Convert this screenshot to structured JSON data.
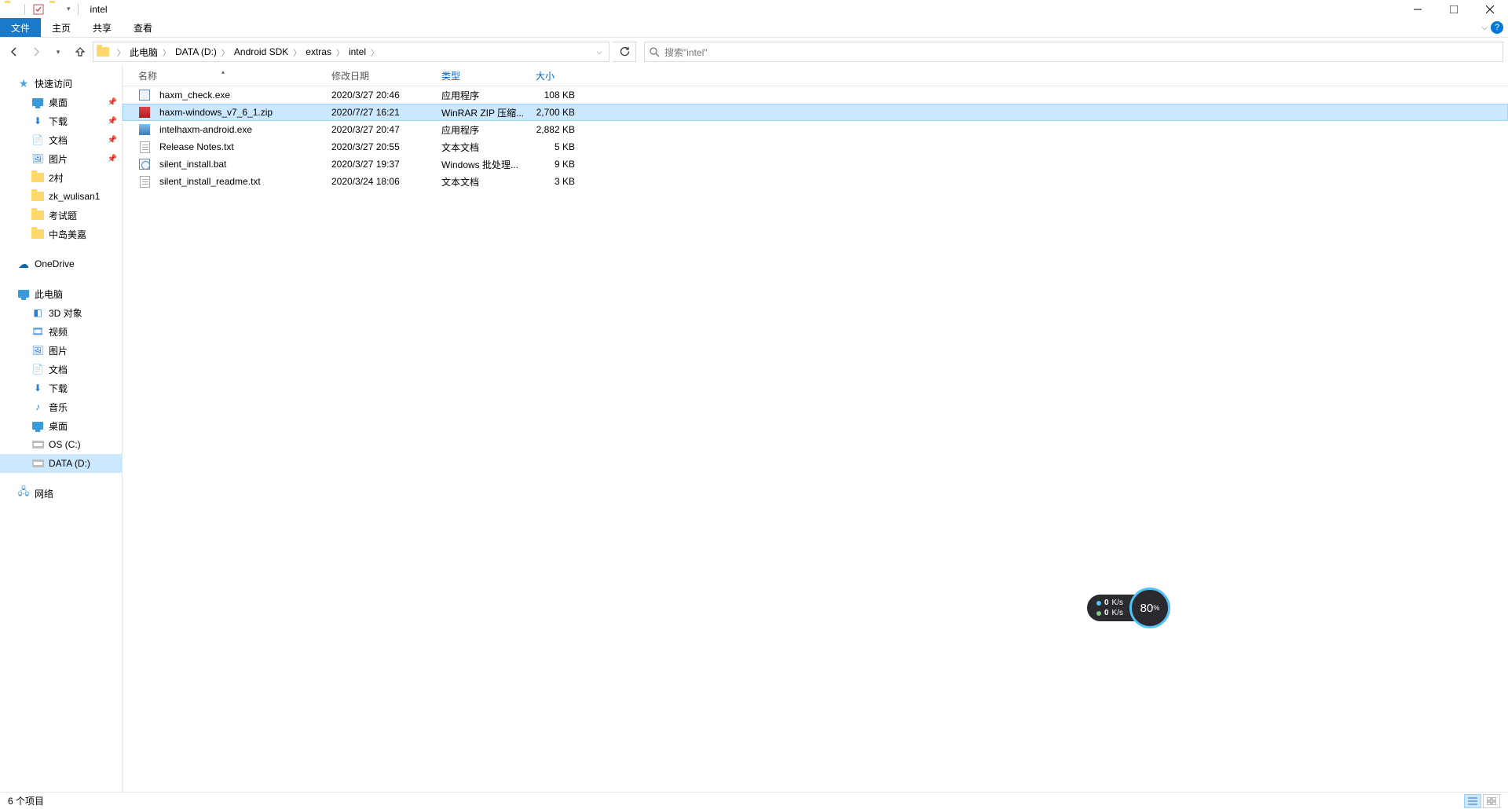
{
  "window": {
    "title": "intel"
  },
  "ribbon": {
    "file": "文件",
    "tabs": [
      "主页",
      "共享",
      "查看"
    ]
  },
  "nav": {
    "breadcrumbs": [
      "此电脑",
      "DATA (D:)",
      "Android SDK",
      "extras",
      "intel"
    ],
    "search_placeholder": "搜索\"intel\""
  },
  "sidebar": {
    "quick_access": "快速访问",
    "quick_items": [
      {
        "label": "桌面",
        "pinned": true,
        "icon": "monitor"
      },
      {
        "label": "下载",
        "pinned": true,
        "icon": "download"
      },
      {
        "label": "文档",
        "pinned": true,
        "icon": "doc"
      },
      {
        "label": "图片",
        "pinned": true,
        "icon": "pic"
      },
      {
        "label": "2村",
        "pinned": false,
        "icon": "folder"
      },
      {
        "label": "zk_wulisan1",
        "pinned": false,
        "icon": "folder"
      },
      {
        "label": "考试题",
        "pinned": false,
        "icon": "folder"
      },
      {
        "label": "中岛美嘉",
        "pinned": false,
        "icon": "folder"
      }
    ],
    "onedrive": "OneDrive",
    "this_pc": "此电脑",
    "pc_items": [
      {
        "label": "3D 对象",
        "icon": "3d"
      },
      {
        "label": "视频",
        "icon": "video"
      },
      {
        "label": "图片",
        "icon": "pic"
      },
      {
        "label": "文档",
        "icon": "doc"
      },
      {
        "label": "下载",
        "icon": "download"
      },
      {
        "label": "音乐",
        "icon": "music"
      },
      {
        "label": "桌面",
        "icon": "monitor"
      },
      {
        "label": "OS (C:)",
        "icon": "drive"
      },
      {
        "label": "DATA (D:)",
        "icon": "drive",
        "selected": true
      }
    ],
    "network": "网络"
  },
  "columns": {
    "name": "名称",
    "date": "修改日期",
    "type": "类型",
    "size": "大小"
  },
  "files": [
    {
      "name": "haxm_check.exe",
      "date": "2020/3/27 20:46",
      "type": "应用程序",
      "size": "108 KB",
      "icon": "exe",
      "selected": false
    },
    {
      "name": "haxm-windows_v7_6_1.zip",
      "date": "2020/7/27 16:21",
      "type": "WinRAR ZIP 压缩...",
      "size": "2,700 KB",
      "icon": "zip",
      "selected": true
    },
    {
      "name": "intelhaxm-android.exe",
      "date": "2020/3/27 20:47",
      "type": "应用程序",
      "size": "2,882 KB",
      "icon": "inst",
      "selected": false
    },
    {
      "name": "Release Notes.txt",
      "date": "2020/3/27 20:55",
      "type": "文本文档",
      "size": "5 KB",
      "icon": "file",
      "selected": false
    },
    {
      "name": "silent_install.bat",
      "date": "2020/3/27 19:37",
      "type": "Windows 批处理...",
      "size": "9 KB",
      "icon": "bat",
      "selected": false
    },
    {
      "name": "silent_install_readme.txt",
      "date": "2020/3/24 18:06",
      "type": "文本文档",
      "size": "3 KB",
      "icon": "file",
      "selected": false
    }
  ],
  "status": {
    "count_text": "6 个项目"
  },
  "widget": {
    "up": "0",
    "up_unit": "K/s",
    "down": "0",
    "down_unit": "K/s",
    "percent": "80",
    "percent_sym": "%"
  }
}
